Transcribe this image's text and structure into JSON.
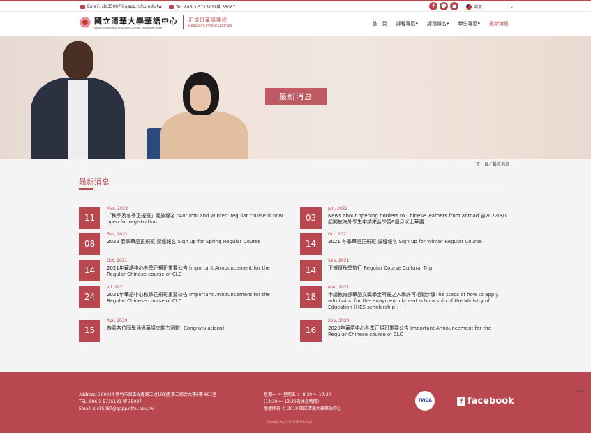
{
  "topbar": {
    "email": "Email: clc35087@gapp.nthu.edu.tw",
    "tel": "Tel: 886-3-5715131轉 35087",
    "language": "中文",
    "social": [
      "f",
      "💬",
      "●"
    ]
  },
  "header": {
    "logo_cn": "國立清華大學華語中心",
    "logo_en": "National Tsing Hua University Chinese Language Center",
    "logo_sub_cn": "正規班華語課程",
    "logo_sub_en": "Regular Chinese Courses",
    "nav": [
      {
        "label": "首　頁",
        "active": false
      },
      {
        "label": "課程專區▾",
        "active": false
      },
      {
        "label": "課程報名▾",
        "active": false
      },
      {
        "label": "學生專區▾",
        "active": false
      },
      {
        "label": "最新消息",
        "active": true
      }
    ]
  },
  "hero": {
    "title": "最新消息"
  },
  "breadcrumb": "首　頁／最新消息",
  "section_title": "最新消息",
  "news": [
    {
      "day": "11",
      "month": "Mar, 2022",
      "title": "「秋季及冬季正規班」開放報名",
      "desc": " \"Autumn and Winter\" regular course is now open for registration"
    },
    {
      "day": "03",
      "month": "Jan, 2022",
      "title": "News about opening borders to Chinese learners from abroad 自2022/3/1 起開放海外學生申請來台學習6個月以上華語",
      "desc": ""
    },
    {
      "day": "08",
      "month": "Feb, 2022",
      "title": "2022 春季華語正規班 課程報名",
      "desc": " Sign up for Spring Regular Course"
    },
    {
      "day": "14",
      "month": "Oct, 2021",
      "title": "2021 冬季華語正規班 課程報名",
      "desc": " Sign up for Winter Regular Course"
    },
    {
      "day": "14",
      "month": "Oct, 2021",
      "title": "2021年華語中心冬季正規班重要公告",
      "desc": " Important Announcement for the Regular Chinese course of CLC"
    },
    {
      "day": "14",
      "month": "Sep, 2021",
      "title": "正規班秋季旅行",
      "desc": " Regular Course Cultural Trip"
    },
    {
      "day": "24",
      "month": "Jul, 2021",
      "title": "2021年華語中心秋季正規班重要公告",
      "desc": " Important Announcement for the Regular Chinese course of CLC"
    },
    {
      "day": "18",
      "month": "Mar, 2021",
      "title": "申請教育部華語文獎學金所需之入學許可相關步驟",
      "desc": "The steps of how to apply admission for the Huayu enrichment scholarship of the Ministry of Education (HES scholarship):"
    },
    {
      "day": "15",
      "month": "Apr, 2020",
      "title": "恭喜各位同學通過華語文能力測驗!",
      "desc": " Congratulations!"
    },
    {
      "day": "16",
      "month": "Sep, 2020",
      "title": "2020年華語中心冬季正規班重要公告",
      "desc": " Important Announcement for the Regular Chinese course of CLC"
    }
  ],
  "footer": {
    "address": "Address: 300044 新竹市東區光復路二段101號 第二綜合大樓6樓 601室",
    "tel": "TEL: 886-3-5715131 轉 35087",
    "email": "Email: clc35087@gapp.nthu.edu.tw",
    "hours": "星期一 ～ 星期五 ： 8:30 ～ 17:30",
    "lunch": "(12:30 ～ 13:30為休息時間)",
    "copyright": "版權所有 © 2019 國立清華大學華語中心",
    "twca": "TWCA",
    "facebook": "facebook",
    "design": "Design by / © GW Design"
  },
  "colors": {
    "accent": "#b8474f"
  }
}
